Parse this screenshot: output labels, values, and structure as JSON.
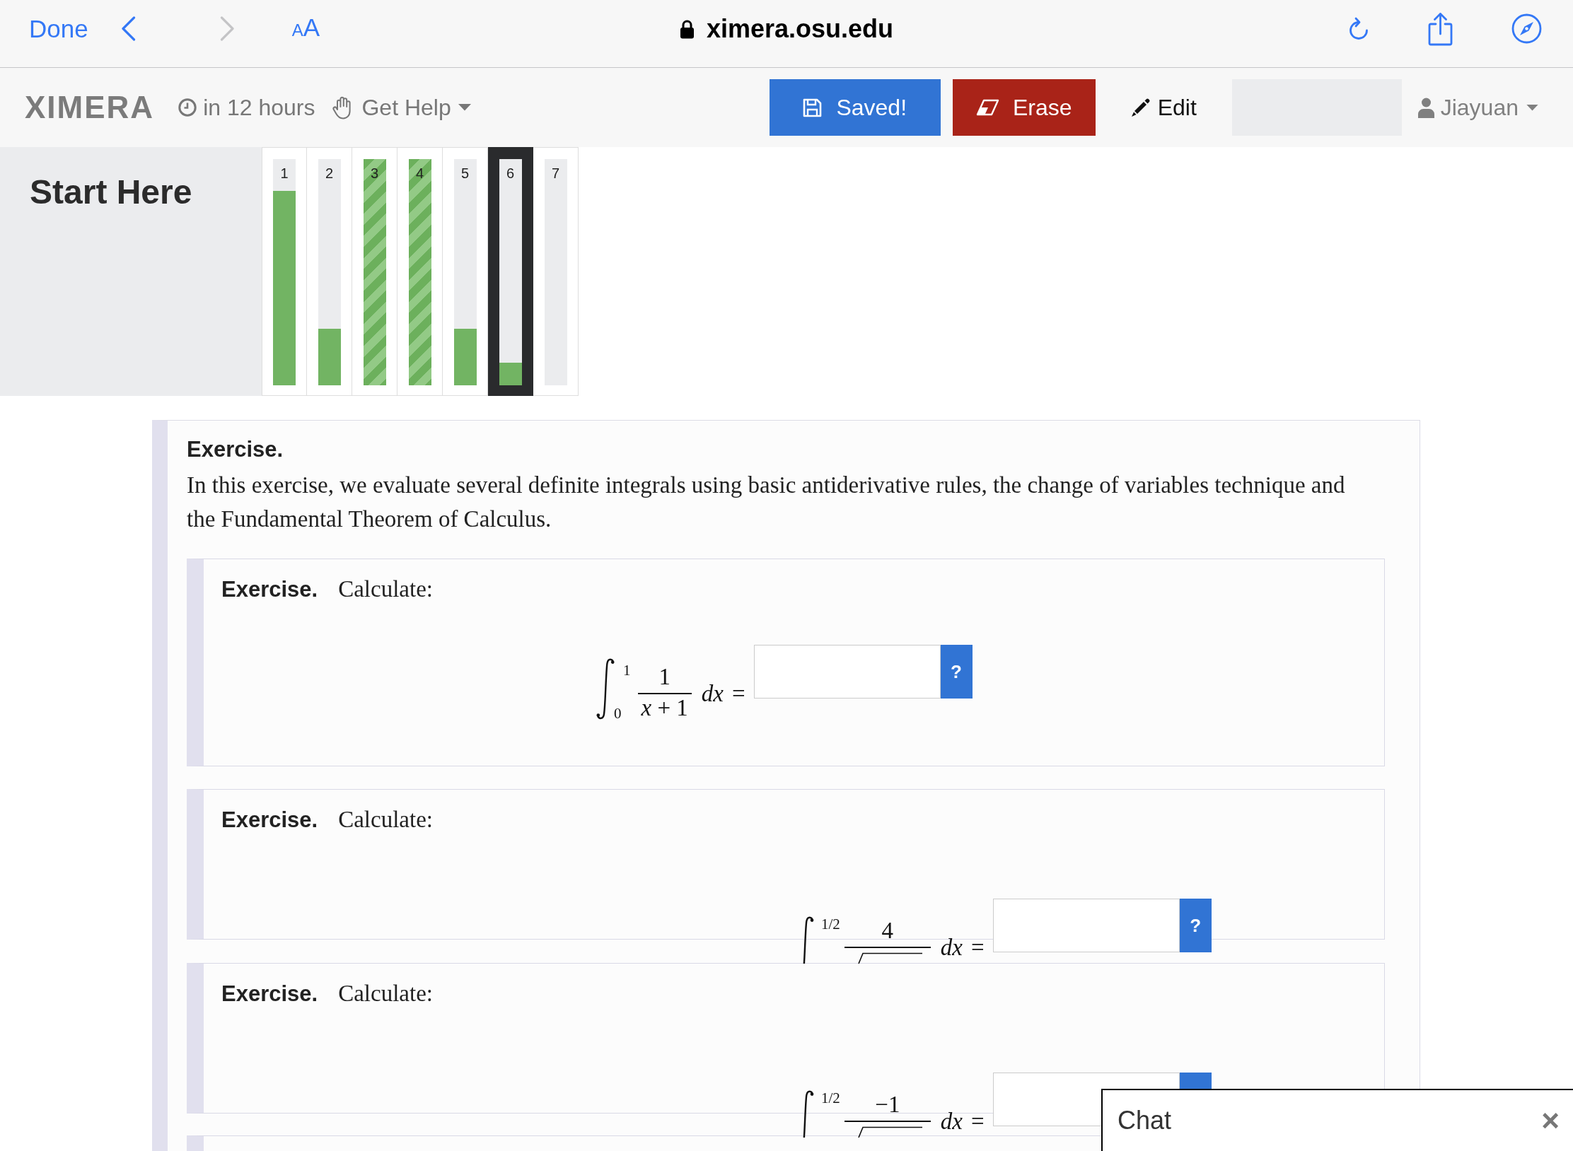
{
  "browser": {
    "done": "Done",
    "nav": [
      {
        "kind": "back",
        "disabled": false
      },
      {
        "kind": "forward",
        "disabled": true
      }
    ],
    "text_size": {
      "small": "A",
      "large": "A"
    },
    "url": "ximera.osu.edu"
  },
  "toolbar": {
    "logo": "XIMERA",
    "due": "in 12 hours",
    "help": "Get Help",
    "buttons": [
      {
        "kind": "save",
        "label": "Saved!"
      },
      {
        "kind": "erase",
        "label": "Erase"
      },
      {
        "kind": "edit",
        "label": "Edit"
      }
    ],
    "user": "Jiayuan"
  },
  "progress": {
    "title": "Start Here",
    "activities": [
      {
        "number": "1",
        "level": 0.86,
        "completed": false,
        "selected": false
      },
      {
        "number": "2",
        "level": 0.25,
        "completed": false,
        "selected": false
      },
      {
        "number": "3",
        "level": 1,
        "completed": true,
        "selected": false
      },
      {
        "number": "4",
        "level": 1,
        "completed": true,
        "selected": false
      },
      {
        "number": "5",
        "level": 0.25,
        "completed": false,
        "selected": false
      },
      {
        "number": "6",
        "level": 0.1,
        "completed": false,
        "selected": true
      },
      {
        "number": "7",
        "completed": false,
        "selected": false
      }
    ]
  },
  "exercise": {
    "heading": "Exercise.",
    "intro": "In this exercise, we evaluate several definite integrals using basic antiderivative rules, the change of variables technique and the Fundamental Theorem of Calculus.",
    "parts": [
      {
        "kind": "full",
        "heading": "Exercise.",
        "prompt": "Calculate:",
        "math": {
          "upper": "1",
          "lower": "0",
          "numerator": "1",
          "denominator": "*x* + 1",
          "differential": "dx",
          "relation": "="
        },
        "help": "?"
      },
      {
        "kind": "clipped",
        "heading": "Exercise.",
        "prompt": "Calculate:",
        "math": {
          "upper": "1/2",
          "numerator": "4",
          "differential": "dx",
          "relation": "="
        },
        "help": "?"
      },
      {
        "kind": "clipped",
        "heading": "Exercise.",
        "prompt": "Calculate:",
        "math": {
          "upper": "1/2",
          "numerator": "−1",
          "differential": "dx",
          "relation": "="
        }
      },
      {
        "kind": "peek"
      }
    ]
  },
  "chat": {
    "title": "Chat",
    "close": "×"
  }
}
